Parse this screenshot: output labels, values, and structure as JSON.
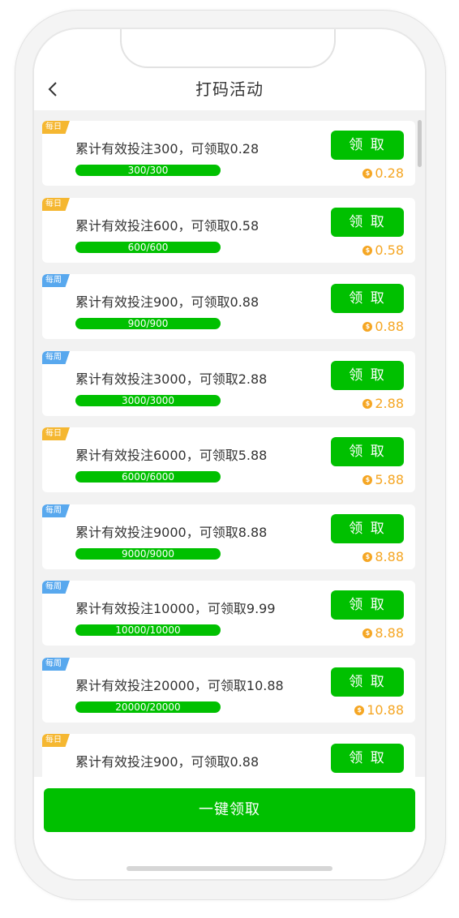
{
  "header": {
    "title": "打码活动"
  },
  "icons": {
    "back": "back-chevron-icon",
    "coin": "coin-icon"
  },
  "colors": {
    "accent": "#00c000",
    "daily_tag": "#f5b731",
    "weekly_tag": "#58a8ee",
    "reward": "#f5a623"
  },
  "tasks": [
    {
      "tag": "每日",
      "tag_type": "daily",
      "text": "累计有效投注300，可领取0.28",
      "progress_text": "300/300",
      "progress": 1.0,
      "button": "领 取",
      "reward": "0.28"
    },
    {
      "tag": "每日",
      "tag_type": "daily",
      "text": "累计有效投注600，可领取0.58",
      "progress_text": "600/600",
      "progress": 1.0,
      "button": "领 取",
      "reward": "0.58"
    },
    {
      "tag": "每周",
      "tag_type": "weekly",
      "text": "累计有效投注900，可领取0.88",
      "progress_text": "900/900",
      "progress": 1.0,
      "button": "领 取",
      "reward": "0.88"
    },
    {
      "tag": "每周",
      "tag_type": "weekly",
      "text": "累计有效投注3000，可领取2.88",
      "progress_text": "3000/3000",
      "progress": 1.0,
      "button": "领 取",
      "reward": "2.88"
    },
    {
      "tag": "每日",
      "tag_type": "daily",
      "text": "累计有效投注6000，可领取5.88",
      "progress_text": "6000/6000",
      "progress": 1.0,
      "button": "领 取",
      "reward": "5.88"
    },
    {
      "tag": "每周",
      "tag_type": "weekly",
      "text": "累计有效投注9000，可领取8.88",
      "progress_text": "9000/9000",
      "progress": 1.0,
      "button": "领 取",
      "reward": "8.88"
    },
    {
      "tag": "每周",
      "tag_type": "weekly",
      "text": "累计有效投注10000，可领取9.99",
      "progress_text": "10000/10000",
      "progress": 1.0,
      "button": "领 取",
      "reward": "8.88"
    },
    {
      "tag": "每周",
      "tag_type": "weekly",
      "text": "累计有效投注20000，可领取10.88",
      "progress_text": "20000/20000",
      "progress": 1.0,
      "button": "领 取",
      "reward": "10.88"
    },
    {
      "tag": "每日",
      "tag_type": "daily",
      "text": "累计有效投注900，可领取0.88",
      "button": "领 取"
    }
  ],
  "footer": {
    "claim_all": "一键领取"
  }
}
